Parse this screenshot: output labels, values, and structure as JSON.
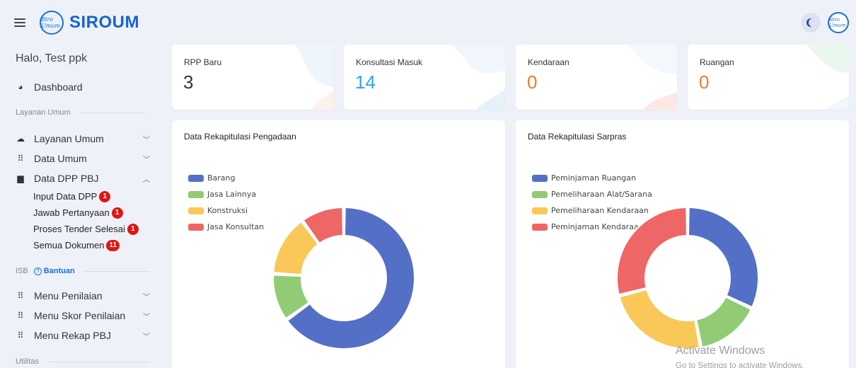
{
  "brand": {
    "name": "SIROUM",
    "logo_text": "Biro Umum"
  },
  "greeting": "Halo, Test ppk",
  "sidebar": {
    "dashboard": "Dashboard",
    "section1": "Layanan Umum",
    "items": [
      {
        "label": "Layanan Umum",
        "icon": "cloud-icon"
      },
      {
        "label": "Data Umum",
        "icon": "grid-icon"
      },
      {
        "label": "Data DPP PBJ",
        "icon": "document-icon"
      }
    ],
    "subitems": [
      {
        "label": "Input Data DPP",
        "badge": "1"
      },
      {
        "label": "Jawab Pertanyaan",
        "badge": "1"
      },
      {
        "label": "Proses Tender Selesai",
        "badge": "1"
      },
      {
        "label": "Semua Dokumen",
        "badge": "11"
      }
    ],
    "section2": "ISB",
    "bantuan": "Bantuan",
    "items2": [
      {
        "label": "Menu Penilaian"
      },
      {
        "label": "Menu Skor Penilaian"
      },
      {
        "label": "Menu Rekap PBJ"
      }
    ],
    "section3": "Utilitas"
  },
  "stats": [
    {
      "label": "RPP Baru",
      "value": "3",
      "color": "#333333"
    },
    {
      "label": "Konsultasi Masuk",
      "value": "14",
      "color": "#27a8e0"
    },
    {
      "label": "Kendaraan",
      "value": "0",
      "color": "#ec7a32"
    },
    {
      "label": "Ruangan",
      "value": "0",
      "color": "#ec7a32"
    }
  ],
  "charts": {
    "pengadaan": {
      "title": "Data Rekapitulasi Pengadaan"
    },
    "sarpras": {
      "title": "Data Rekapitulasi Sarpras"
    }
  },
  "chart_data": [
    {
      "type": "pie",
      "title": "Data Rekapitulasi Pengadaan",
      "categories": [
        "Barang",
        "Jasa Lainnya",
        "Konstruksi",
        "Jasa Konsultan"
      ],
      "values": [
        65,
        11,
        14,
        10
      ],
      "colors": [
        "#5470c6",
        "#91cc75",
        "#fac858",
        "#ee6666"
      ],
      "legend_position": "top-left"
    },
    {
      "type": "pie",
      "title": "Data Rekapitulasi Sarpras",
      "categories": [
        "Peminjaman Ruangan",
        "Pemeliharaan Alat/Sarana",
        "Pemeliharaan Kendaraan",
        "Peminjaman Kendaraan"
      ],
      "values": [
        32,
        15,
        24,
        29
      ],
      "colors": [
        "#5470c6",
        "#91cc75",
        "#fac858",
        "#ee6666"
      ],
      "legend_position": "top-left"
    }
  ],
  "watermark": {
    "line1": "Activate Windows",
    "line2": "Go to Settings to activate Windows."
  }
}
